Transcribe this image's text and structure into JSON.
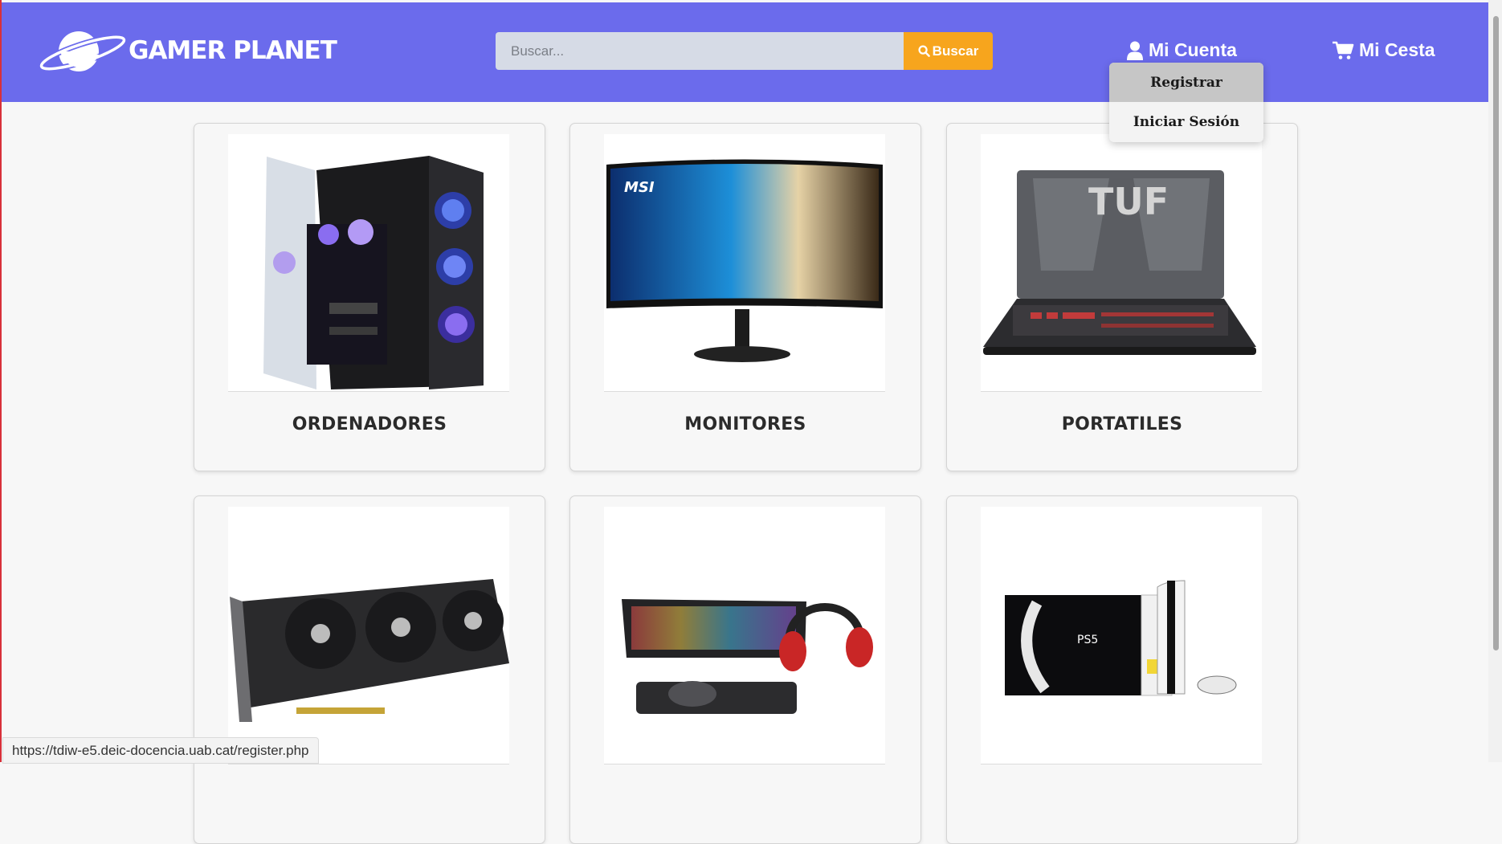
{
  "header": {
    "brand": "GAMER PLANET",
    "search": {
      "placeholder": "Buscar...",
      "value": "",
      "button_label": "Buscar"
    },
    "account_label": "Mi Cuenta",
    "cart_label": "Mi Cesta"
  },
  "account_menu": {
    "items": [
      "Registrar",
      "Iniciar Sesión"
    ],
    "highlighted": "Registrar"
  },
  "categories": [
    {
      "title": "ORDENADORES",
      "image": "gaming-pc-tower"
    },
    {
      "title": "MONITORES",
      "image": "msi-curved-monitor"
    },
    {
      "title": "PORTATILES",
      "image": "asus-tuf-laptop"
    },
    {
      "title": "",
      "image": "graphics-card"
    },
    {
      "title": "",
      "image": "keyboard-mouse-headset-kit"
    },
    {
      "title": "",
      "image": "ps5-console"
    }
  ],
  "status_bar": {
    "url": "https://tdiw-e5.deic-docencia.uab.cat/register.php"
  },
  "colors": {
    "header": "#6b6bec",
    "search_button": "#f7a51d",
    "menu_highlight": "#c6c6c6"
  }
}
